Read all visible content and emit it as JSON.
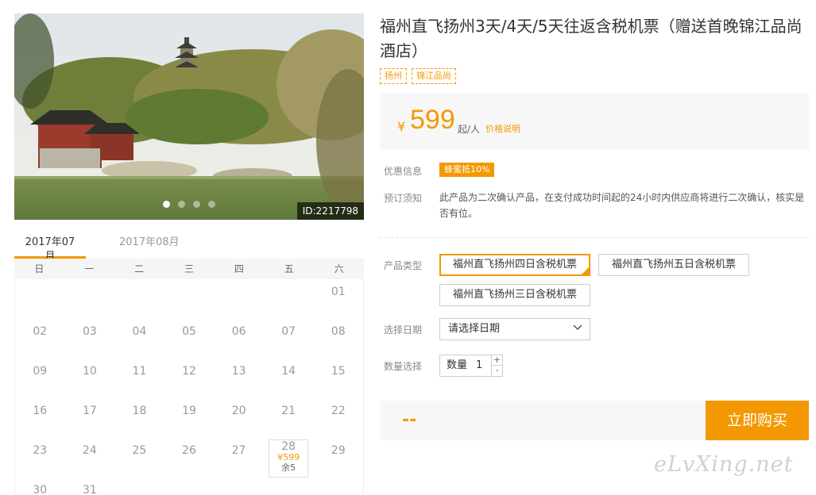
{
  "gallery": {
    "image_id": "ID:2217798",
    "slide_count": 4,
    "active_slide": 1
  },
  "calendar": {
    "tabs": [
      "2017年07月",
      "2017年08月"
    ],
    "active_tab": 0,
    "weekdays": [
      "日",
      "一",
      "二",
      "三",
      "四",
      "五",
      "六"
    ],
    "weeks": [
      [
        "",
        "",
        "",
        "",
        "",
        "",
        "01"
      ],
      [
        "02",
        "03",
        "04",
        "05",
        "06",
        "07",
        "08"
      ],
      [
        "09",
        "10",
        "11",
        "12",
        "13",
        "14",
        "15"
      ],
      [
        "16",
        "17",
        "18",
        "19",
        "20",
        "21",
        "22"
      ],
      [
        "23",
        "24",
        "25",
        "26",
        "27",
        "28",
        "29"
      ],
      [
        "30",
        "31",
        "",
        "",
        "",
        "",
        ""
      ]
    ],
    "available": {
      "day": "28",
      "price": "¥599",
      "remaining": "余5"
    }
  },
  "product": {
    "title": "福州直飞扬州3天/4天/5天往返含税机票（赠送首晚锦江品尚酒店）",
    "tags": [
      "扬州",
      "锦江品尚"
    ],
    "price": {
      "currency": "¥",
      "amount": "599",
      "suffix": "起/人",
      "explain_link": "价格说明"
    },
    "promo": {
      "label": "优惠信息",
      "badge": "蜂蜜抵10%"
    },
    "notice": {
      "label": "预订须知",
      "text": "此产品为二次确认产品，在支付成功时间起的24小时内供应商将进行二次确认，核实是否有位。"
    },
    "product_type": {
      "label": "产品类型",
      "options": [
        "福州直飞扬州四日含税机票",
        "福州直飞扬州五日含税机票",
        "福州直飞扬州三日含税机票"
      ],
      "selected": 0
    },
    "date": {
      "label": "选择日期",
      "placeholder": "请选择日期"
    },
    "quantity": {
      "label": "数量选择",
      "field_label": "数量",
      "value": "1",
      "plus": "+",
      "minus": "-"
    },
    "total": "--",
    "buy_button": "立即购买"
  },
  "watermark": "eLvXing.net",
  "colors": {
    "accent": "#f39800",
    "panel_bg": "#f7f7f7"
  }
}
